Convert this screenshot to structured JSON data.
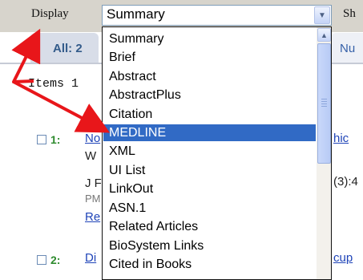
{
  "toolbar": {
    "display_label": "Display",
    "format_select_value": "Summary",
    "sh_label": "Sh"
  },
  "tabs": {
    "all_label": "All: 2",
    "right_partial_label": "Nu"
  },
  "items_text": "Items 1",
  "results": [
    {
      "number": "1:",
      "link": "No",
      "line2": "W",
      "line3": "J F",
      "line4": "PM",
      "link2": "Re",
      "right_link": "hic",
      "right_text": "(3):4"
    },
    {
      "number": "2:",
      "link": "Di",
      "right_link": "cup"
    }
  ],
  "dropdown": {
    "options": [
      "Summary",
      "Brief",
      "Abstract",
      "AbstractPlus",
      "Citation",
      "MEDLINE",
      "XML",
      "UI List",
      "LinkOut",
      "ASN.1",
      "Related Articles",
      "BioSystem Links",
      "Cited in Books"
    ],
    "selected": "MEDLINE"
  },
  "colors": {
    "selection": "#316ac5",
    "annotation_arrow": "#e8161a",
    "link": "#1f44b8"
  }
}
